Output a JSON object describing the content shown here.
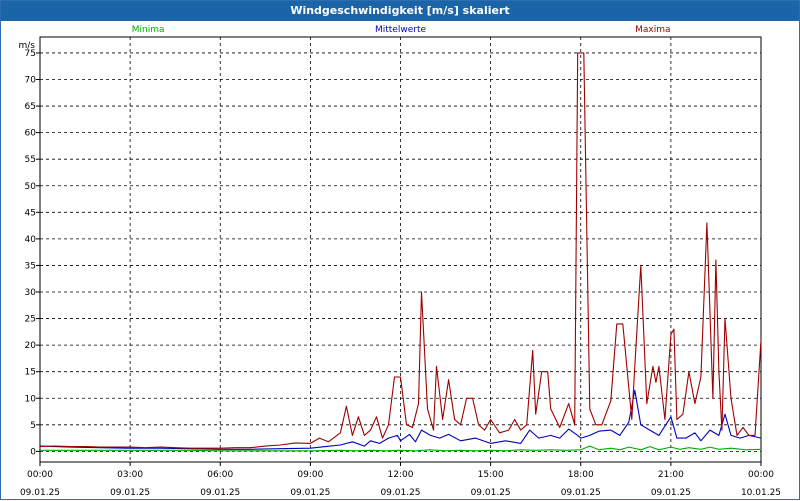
{
  "window": {
    "title": "Windgeschwindigkeit [m/s] skaliert"
  },
  "colors": {
    "titlebar": "#1c64a8",
    "minima": "#00b000",
    "mittelwerte": "#0000c0",
    "maxima": "#a00000"
  },
  "chart_data": {
    "type": "line",
    "title": "Windgeschwindigkeit [m/s] skaliert",
    "ylabel": "m/s",
    "xlabel": "",
    "ylim": [
      -2,
      78
    ],
    "y_ticks": [
      0,
      5,
      10,
      15,
      20,
      25,
      30,
      35,
      40,
      45,
      50,
      55,
      60,
      65,
      70,
      75
    ],
    "x_ticks": [
      {
        "time": "00:00",
        "date": "09.01.25"
      },
      {
        "time": "03:00",
        "date": "09.01.25"
      },
      {
        "time": "06:00",
        "date": "09.01.25"
      },
      {
        "time": "09:00",
        "date": "09.01.25"
      },
      {
        "time": "12:00",
        "date": "09.01.25"
      },
      {
        "time": "15:00",
        "date": "09.01.25"
      },
      {
        "time": "18:00",
        "date": "09.01.25"
      },
      {
        "time": "21:00",
        "date": "09.01.25"
      },
      {
        "time": "00:00",
        "date": "10.01.25"
      }
    ],
    "grid": true,
    "legend_position": "top",
    "series": [
      {
        "name": "Minima",
        "color": "#00b000",
        "points": [
          [
            0,
            0.2
          ],
          [
            1,
            0.2
          ],
          [
            2,
            0.2
          ],
          [
            3,
            0.2
          ],
          [
            4,
            0.2
          ],
          [
            5,
            0.2
          ],
          [
            6,
            0.1
          ],
          [
            7,
            0.1
          ],
          [
            8,
            0.1
          ],
          [
            9,
            0.1
          ],
          [
            10,
            0.2
          ],
          [
            10.5,
            0.1
          ],
          [
            11,
            0.2
          ],
          [
            11.5,
            0.1
          ],
          [
            12,
            0.2
          ],
          [
            12.5,
            0.1
          ],
          [
            13,
            0.3
          ],
          [
            13.5,
            0.1
          ],
          [
            14,
            0.2
          ],
          [
            14.5,
            0.1
          ],
          [
            15,
            0.2
          ],
          [
            15.5,
            0.1
          ],
          [
            16,
            0.3
          ],
          [
            16.5,
            0.2
          ],
          [
            17,
            0.3
          ],
          [
            17.5,
            0.2
          ],
          [
            18,
            0.3
          ],
          [
            18.3,
            1.0
          ],
          [
            18.6,
            0.3
          ],
          [
            19,
            0.6
          ],
          [
            19.3,
            0.3
          ],
          [
            19.6,
            0.8
          ],
          [
            20,
            0.3
          ],
          [
            20.3,
            0.9
          ],
          [
            20.6,
            0.3
          ],
          [
            21,
            0.8
          ],
          [
            21.3,
            0.4
          ],
          [
            21.6,
            0.7
          ],
          [
            22,
            0.4
          ],
          [
            22.3,
            0.8
          ],
          [
            22.6,
            0.4
          ],
          [
            23,
            0.6
          ],
          [
            23.5,
            0.3
          ],
          [
            24,
            0.4
          ]
        ]
      },
      {
        "name": "Mittelwerte",
        "color": "#0000c0",
        "points": [
          [
            0,
            1.0
          ],
          [
            1,
            0.8
          ],
          [
            2,
            0.7
          ],
          [
            3,
            0.6
          ],
          [
            4,
            0.6
          ],
          [
            5,
            0.5
          ],
          [
            6,
            0.4
          ],
          [
            7,
            0.4
          ],
          [
            8,
            0.5
          ],
          [
            9,
            0.6
          ],
          [
            9.5,
            0.9
          ],
          [
            10,
            1.2
          ],
          [
            10.4,
            1.8
          ],
          [
            10.8,
            1.0
          ],
          [
            11,
            2.0
          ],
          [
            11.3,
            1.5
          ],
          [
            11.6,
            2.5
          ],
          [
            11.9,
            3.0
          ],
          [
            12,
            2.0
          ],
          [
            12.3,
            3.2
          ],
          [
            12.5,
            1.8
          ],
          [
            12.7,
            4.0
          ],
          [
            13,
            3.0
          ],
          [
            13.3,
            2.5
          ],
          [
            13.6,
            3.2
          ],
          [
            14,
            2.0
          ],
          [
            14.5,
            2.5
          ],
          [
            15,
            1.5
          ],
          [
            15.5,
            2.0
          ],
          [
            16,
            1.5
          ],
          [
            16.3,
            4.0
          ],
          [
            16.6,
            2.5
          ],
          [
            17,
            3.0
          ],
          [
            17.3,
            2.5
          ],
          [
            17.6,
            4.2
          ],
          [
            17.9,
            3.0
          ],
          [
            18,
            2.5
          ],
          [
            18.3,
            3.0
          ],
          [
            18.6,
            3.8
          ],
          [
            19,
            4.0
          ],
          [
            19.3,
            3.0
          ],
          [
            19.6,
            5.5
          ],
          [
            19.8,
            11.5
          ],
          [
            20,
            5.0
          ],
          [
            20.3,
            4.0
          ],
          [
            20.6,
            3.0
          ],
          [
            21,
            6.5
          ],
          [
            21.2,
            2.5
          ],
          [
            21.5,
            2.5
          ],
          [
            21.8,
            3.5
          ],
          [
            22,
            2.0
          ],
          [
            22.3,
            4.0
          ],
          [
            22.6,
            3.0
          ],
          [
            22.8,
            7.0
          ],
          [
            23,
            3.0
          ],
          [
            23.3,
            2.5
          ],
          [
            23.6,
            3.0
          ],
          [
            24,
            2.5
          ]
        ]
      },
      {
        "name": "Maxima",
        "color": "#a00000",
        "points": [
          [
            0,
            0.9
          ],
          [
            0.5,
            1.0
          ],
          [
            1,
            0.9
          ],
          [
            1.5,
            0.9
          ],
          [
            2,
            0.8
          ],
          [
            2.5,
            0.8
          ],
          [
            3,
            0.8
          ],
          [
            3.5,
            0.7
          ],
          [
            4,
            0.8
          ],
          [
            4.5,
            0.7
          ],
          [
            5,
            0.6
          ],
          [
            5.5,
            0.6
          ],
          [
            6,
            0.6
          ],
          [
            6.5,
            0.7
          ],
          [
            7,
            0.7
          ],
          [
            7.5,
            1.0
          ],
          [
            8,
            1.2
          ],
          [
            8.5,
            1.6
          ],
          [
            9,
            1.5
          ],
          [
            9.3,
            2.5
          ],
          [
            9.6,
            1.8
          ],
          [
            10,
            3.5
          ],
          [
            10.2,
            8.5
          ],
          [
            10.4,
            3.0
          ],
          [
            10.6,
            6.5
          ],
          [
            10.8,
            3.0
          ],
          [
            11,
            4.0
          ],
          [
            11.2,
            6.5
          ],
          [
            11.4,
            2.5
          ],
          [
            11.6,
            5.0
          ],
          [
            11.8,
            14.0
          ],
          [
            12,
            14.0
          ],
          [
            12.2,
            5.0
          ],
          [
            12.4,
            4.5
          ],
          [
            12.6,
            9.0
          ],
          [
            12.7,
            30.0
          ],
          [
            12.9,
            8.0
          ],
          [
            13.1,
            4.0
          ],
          [
            13.2,
            16.0
          ],
          [
            13.4,
            6.0
          ],
          [
            13.6,
            13.5
          ],
          [
            13.8,
            6.0
          ],
          [
            14,
            5.0
          ],
          [
            14.2,
            10.0
          ],
          [
            14.4,
            10.0
          ],
          [
            14.6,
            5.0
          ],
          [
            14.8,
            4.0
          ],
          [
            15,
            6.0
          ],
          [
            15.3,
            3.5
          ],
          [
            15.6,
            4.0
          ],
          [
            15.8,
            6.0
          ],
          [
            16,
            4.0
          ],
          [
            16.2,
            5.0
          ],
          [
            16.4,
            19.0
          ],
          [
            16.5,
            7.0
          ],
          [
            16.7,
            15.0
          ],
          [
            16.9,
            15.0
          ],
          [
            17,
            8.0
          ],
          [
            17.3,
            4.5
          ],
          [
            17.6,
            9.0
          ],
          [
            17.8,
            5.0
          ],
          [
            17.9,
            75.0
          ],
          [
            18.1,
            75.0
          ],
          [
            18.3,
            8.0
          ],
          [
            18.5,
            5.0
          ],
          [
            18.7,
            5.0
          ],
          [
            19,
            9.5
          ],
          [
            19.2,
            24.0
          ],
          [
            19.4,
            24.0
          ],
          [
            19.7,
            6.0
          ],
          [
            19.8,
            16.0
          ],
          [
            20,
            35.0
          ],
          [
            20.2,
            9.0
          ],
          [
            20.4,
            16.0
          ],
          [
            20.5,
            13.0
          ],
          [
            20.6,
            16.0
          ],
          [
            20.8,
            6.0
          ],
          [
            21,
            22.0
          ],
          [
            21.1,
            23.0
          ],
          [
            21.2,
            6.0
          ],
          [
            21.4,
            7.0
          ],
          [
            21.6,
            15.0
          ],
          [
            21.8,
            9.0
          ],
          [
            22,
            14.0
          ],
          [
            22.2,
            43.0
          ],
          [
            22.4,
            10.0
          ],
          [
            22.5,
            36.0
          ],
          [
            22.6,
            15.0
          ],
          [
            22.7,
            4.0
          ],
          [
            22.8,
            25.0
          ],
          [
            23,
            10.0
          ],
          [
            23.2,
            3.0
          ],
          [
            23.4,
            4.5
          ],
          [
            23.6,
            3.0
          ],
          [
            23.8,
            3.0
          ],
          [
            24,
            21.0
          ]
        ]
      }
    ]
  }
}
